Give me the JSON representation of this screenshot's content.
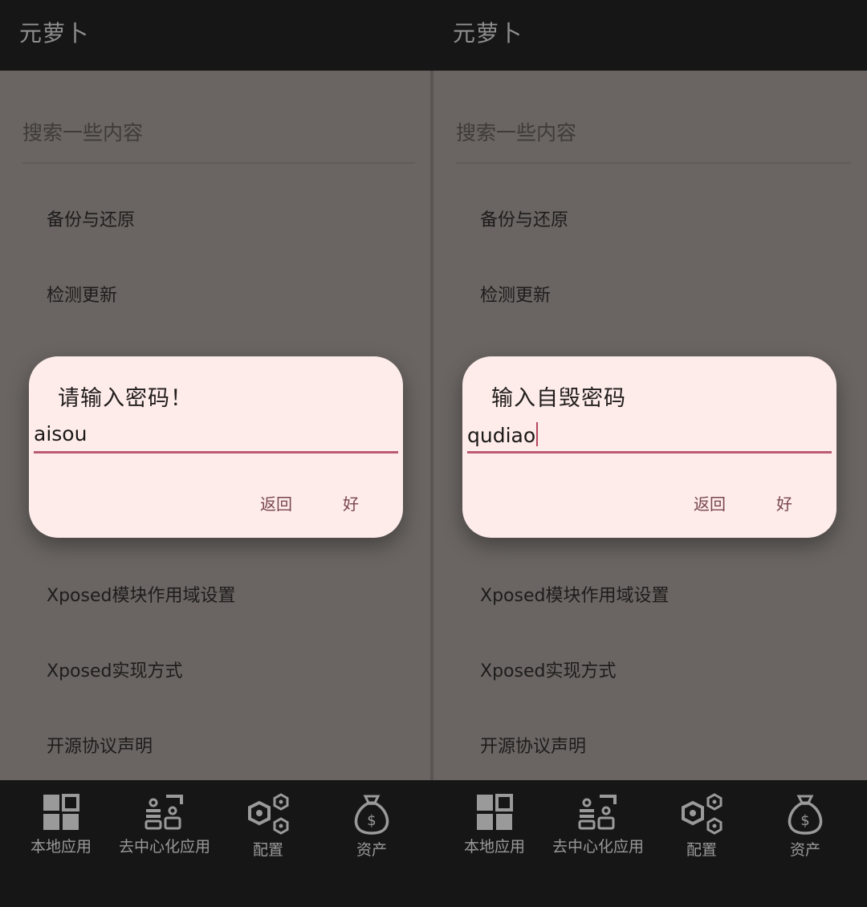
{
  "left": {
    "app_title": "元萝卜",
    "search_placeholder": "搜索一些内容",
    "menu": {
      "backup": "备份与还原",
      "check_update": "检测更新",
      "xposed_scope": "Xposed模块作用域设置",
      "xposed_impl": "Xposed实现方式",
      "open_source": "开源协议声明"
    },
    "dialog": {
      "title": "请输入密码！",
      "input_value": "aisou",
      "back_label": "返回",
      "ok_label": "好"
    },
    "nav": {
      "local_apps": "本地应用",
      "decentralized_apps": "去中心化应用",
      "config": "配置",
      "assets": "资产"
    }
  },
  "right": {
    "app_title": "元萝卜",
    "search_placeholder": "搜索一些内容",
    "menu": {
      "backup": "备份与还原",
      "check_update": "检测更新",
      "xposed_scope": "Xposed模块作用域设置",
      "xposed_impl": "Xposed实现方式",
      "open_source": "开源协议声明"
    },
    "dialog": {
      "title": "输入自毁密码",
      "input_value": "qudiao",
      "back_label": "返回",
      "ok_label": "好"
    },
    "nav": {
      "local_apps": "本地应用",
      "decentralized_apps": "去中心化应用",
      "config": "配置",
      "assets": "资产"
    }
  },
  "icons": {
    "local_apps": "grid-icon",
    "decentralized_apps": "people-network-icon",
    "config": "hexagons-icon",
    "assets": "money-bag-icon"
  },
  "colors": {
    "dialog_bg": "#fdecea",
    "accent": "#bd5a73",
    "scrim": "#6a6562",
    "bar_bg": "#161616"
  }
}
